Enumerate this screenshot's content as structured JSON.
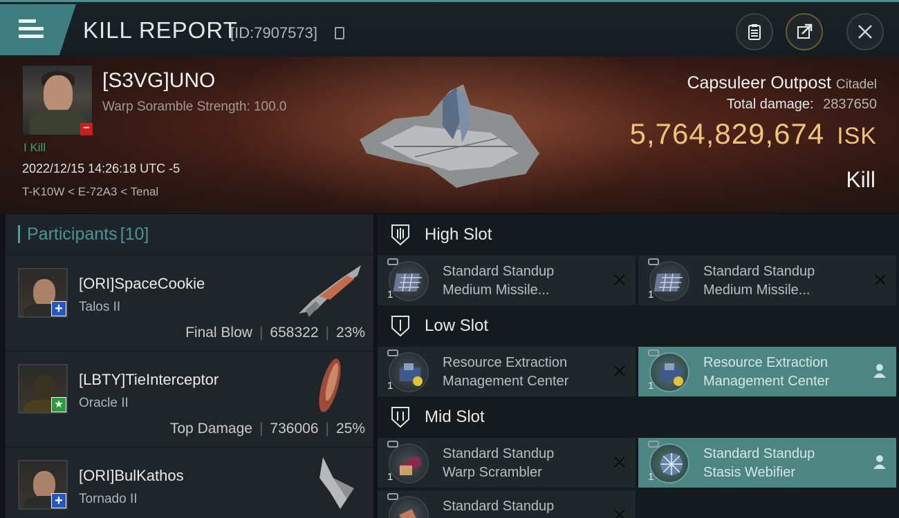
{
  "header": {
    "title": "KILL REPORT",
    "report_id": "[ID:7907573]"
  },
  "victim": {
    "name": "[S3VG]UNO",
    "detail": "Warp Soramble Strength: 100.0",
    "kill_tag": "I Kill",
    "datetime": "2022/12/15 14:26:18 UTC -5",
    "location": "T-K10W < E-72A3 < Tenal",
    "structure_name": "Capsuleer Outpost",
    "structure_class": "Citadel",
    "total_damage_label": "Total damage:",
    "total_damage": "2837650",
    "isk_value": "5,764,829,674",
    "isk_unit": "ISK",
    "kill_type": "Kill"
  },
  "participants": {
    "label": "Participants",
    "count": "[10]",
    "rows": [
      {
        "name": "[ORI]SpaceCookie",
        "ship": "Talos II",
        "role": "Final Blow",
        "damage": "658322",
        "percent": "23%",
        "badge": "+"
      },
      {
        "name": "[LBTY]TieInterceptor",
        "ship": "Oracle II",
        "role": "Top Damage",
        "damage": "736006",
        "percent": "25%",
        "badge": "★"
      },
      {
        "name": "[ORI]BulKathos",
        "ship": "Tornado II",
        "role": "",
        "damage": "",
        "percent": "",
        "badge": "+"
      }
    ]
  },
  "slots": {
    "high": {
      "label": "High Slot",
      "modules": [
        {
          "qty": "1",
          "line1": "Standard Standup",
          "line2": "Medium Missile..."
        },
        {
          "qty": "1",
          "line1": "Standard Standup",
          "line2": "Medium Missile..."
        }
      ]
    },
    "low": {
      "label": "Low Slot",
      "modules": [
        {
          "qty": "1",
          "line1": "Resource Extraction",
          "line2": "Management Center"
        },
        {
          "qty": "1",
          "line1": "Resource Extraction",
          "line2": "Management Center"
        }
      ]
    },
    "mid": {
      "label": "Mid Slot",
      "modules": [
        {
          "qty": "1",
          "line1": "Standard Standup",
          "line2": "Warp Scrambler"
        },
        {
          "qty": "1",
          "line1": "Standard Standup",
          "line2": "Stasis Webifier"
        },
        {
          "qty": "",
          "line1": "Standard Standup",
          "line2": ""
        }
      ]
    }
  },
  "colors": {
    "accent": "#4c8e8e",
    "isk": "#eec37a",
    "fitted_module_bg": "#4d8582"
  }
}
